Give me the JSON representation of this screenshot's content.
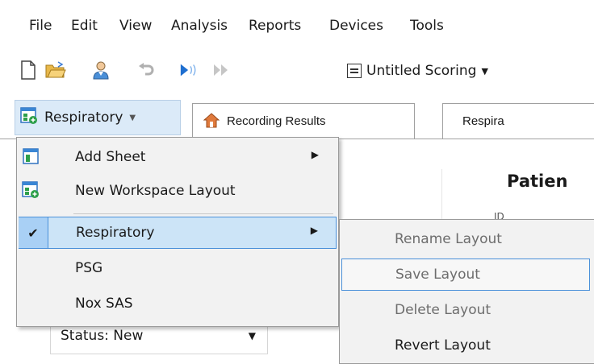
{
  "menubar": {
    "items": [
      "File",
      "Edit",
      "View",
      "Analysis",
      "Reports",
      "Devices",
      "Tools"
    ]
  },
  "toolbar": {
    "icons": [
      "new-document-icon",
      "open-folder-icon",
      "patient-icon",
      "undo-icon",
      "play-icon",
      "fast-forward-icon"
    ],
    "scoring_label": "Untitled Scoring"
  },
  "tabs": {
    "layout_button_label": "Respiratory",
    "recording_results": "Recording Results",
    "respiratory_partial": "Respira"
  },
  "content": {
    "patient_heading": "Patien",
    "id_label": "ID",
    "status_value": "Status: New"
  },
  "context_menu": {
    "items": [
      {
        "label": "Add Sheet",
        "submenu": true
      },
      {
        "label": "New Workspace Layout",
        "submenu": false
      },
      {
        "label": "Respiratory",
        "submenu": true,
        "checked": true
      },
      {
        "label": "PSG",
        "submenu": false
      },
      {
        "label": "Nox SAS",
        "submenu": false
      }
    ]
  },
  "submenu": {
    "items": [
      {
        "label": "Rename Layout",
        "enabled": false
      },
      {
        "label": "Save Layout",
        "enabled": false
      },
      {
        "label": "Delete Layout",
        "enabled": false
      },
      {
        "label": "Revert Layout",
        "enabled": true
      }
    ]
  },
  "colors": {
    "highlight_bg": "#cce4f7",
    "highlight_border": "#4a90d9",
    "menu_bg": "#f2f2f2",
    "layout_button_bg": "#dbeaf8"
  }
}
